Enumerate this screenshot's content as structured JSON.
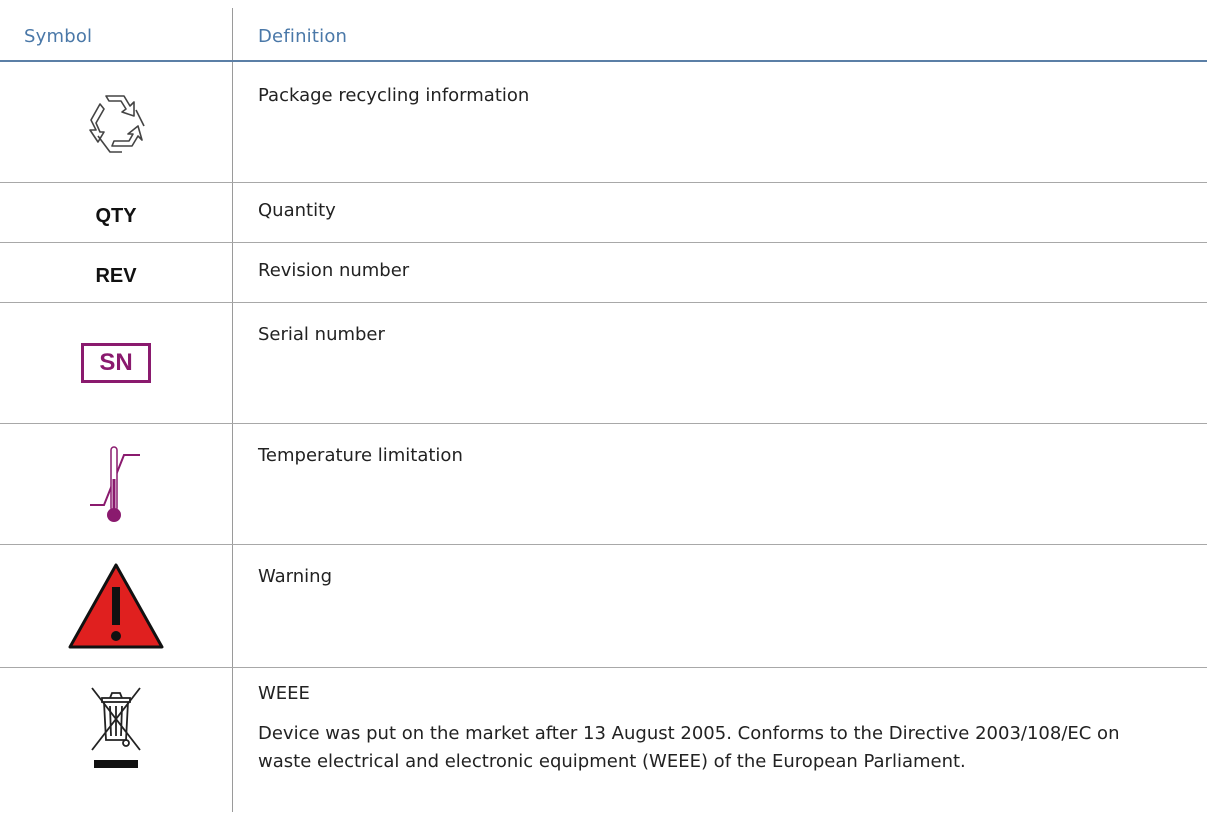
{
  "header": {
    "symbol": "Symbol",
    "definition": "Definition"
  },
  "rows": [
    {
      "icon": "recycle-icon",
      "definition": "Package recycling information"
    },
    {
      "symbol_text": "QTY",
      "definition": "Quantity"
    },
    {
      "symbol_text": "REV",
      "definition": "Revision number"
    },
    {
      "symbol_text": "SN",
      "icon": "serial-number-icon",
      "definition": "Serial number"
    },
    {
      "icon": "temperature-limit-icon",
      "definition": "Temperature limitation"
    },
    {
      "icon": "warning-icon",
      "definition": "Warning"
    },
    {
      "icon": "weee-crossed-bin-icon",
      "definition": "WEEE",
      "note": "Device was put on the market after 13 August 2005. Conforms to the Directive 2003/108/EC on waste electrical and electronic equipment (WEEE) of the European Parliament."
    }
  ],
  "colors": {
    "header_text": "#4a78a8",
    "header_rule": "#5b7fa6",
    "sn_purple": "#8a1a6e",
    "warning_red": "#e0201f"
  }
}
